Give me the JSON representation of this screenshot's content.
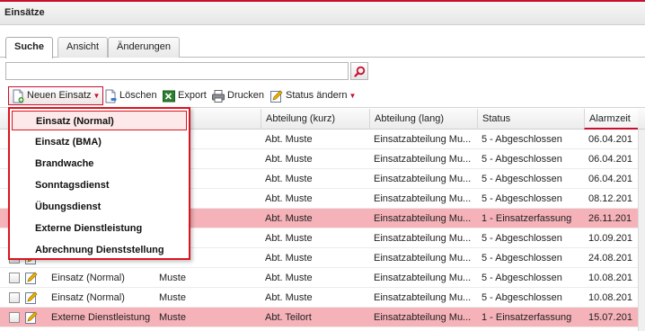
{
  "panel": {
    "title": "Einsätze"
  },
  "tabs": [
    {
      "label": "Suche",
      "active": true
    },
    {
      "label": "Ansicht",
      "active": false
    },
    {
      "label": "Änderungen",
      "active": false
    }
  ],
  "search": {
    "value": "",
    "placeholder": ""
  },
  "toolbar": {
    "new_label": "Neuen Einsatz",
    "delete_label": "Löschen",
    "export_label": "Export",
    "print_label": "Drucken",
    "status_label": "Status ändern"
  },
  "columns": {
    "abteilung_kurz": "Abteilung (kurz)",
    "abteilung_lang": "Abteilung (lang)",
    "status": "Status",
    "alarmzeit": "Alarmzeit"
  },
  "rows": [
    {
      "art": "",
      "name": "",
      "abt_kurz": "Abt. Muste",
      "abt_lang": "Einsatzabteilung Mu...",
      "status": "5 - Abgeschlossen",
      "alarm": "06.04.201",
      "alert": false
    },
    {
      "art": "",
      "name": "",
      "abt_kurz": "Abt. Muste",
      "abt_lang": "Einsatzabteilung Mu...",
      "status": "5 - Abgeschlossen",
      "alarm": "06.04.201",
      "alert": false
    },
    {
      "art": "",
      "name": "",
      "abt_kurz": "Abt. Muste",
      "abt_lang": "Einsatzabteilung Mu...",
      "status": "5 - Abgeschlossen",
      "alarm": "06.04.201",
      "alert": false
    },
    {
      "art": "",
      "name": "",
      "abt_kurz": "Abt. Muste",
      "abt_lang": "Einsatzabteilung Mu...",
      "status": "5 - Abgeschlossen",
      "alarm": "08.12.201",
      "alert": false
    },
    {
      "art": "",
      "name": "",
      "abt_kurz": "Abt. Muste",
      "abt_lang": "Einsatzabteilung Mu...",
      "status": "1 - Einsatzerfassung",
      "alarm": "26.11.201",
      "alert": true
    },
    {
      "art": "",
      "name": "",
      "abt_kurz": "Abt. Muste",
      "abt_lang": "Einsatzabteilung Mu...",
      "status": "5 - Abgeschlossen",
      "alarm": "10.09.201",
      "alert": false
    },
    {
      "art": "",
      "name": "",
      "abt_kurz": "Abt. Muste",
      "abt_lang": "Einsatzabteilung Mu...",
      "status": "5 - Abgeschlossen",
      "alarm": "24.08.201",
      "alert": false
    },
    {
      "art": "Einsatz (Normal)",
      "name": "Muste",
      "abt_kurz": "Abt. Muste",
      "abt_lang": "Einsatzabteilung Mu...",
      "status": "5 - Abgeschlossen",
      "alarm": "10.08.201",
      "alert": false
    },
    {
      "art": "Einsatz (Normal)",
      "name": "Muste",
      "abt_kurz": "Abt. Muste",
      "abt_lang": "Einsatzabteilung Mu...",
      "status": "5 - Abgeschlossen",
      "alarm": "10.08.201",
      "alert": false
    },
    {
      "art": "Externe Dienstleistung",
      "name": "Muste",
      "abt_kurz": "Abt. Teilort",
      "abt_lang": "Einsatzabteilung Mu...",
      "status": "1 - Einsatzerfassung",
      "alarm": "15.07.201",
      "alert": true
    }
  ],
  "dropdown": {
    "items": [
      "Einsatz (Normal)",
      "Einsatz (BMA)",
      "Brandwache",
      "Sonntagsdienst",
      "Übungsdienst",
      "Externe Dienstleistung",
      "Abrechnung Dienststellung"
    ],
    "highlighted_index": 0
  },
  "colors": {
    "accent": "#c8102e",
    "alert_row": "#f5b2b8",
    "menu_border": "#d9151f"
  }
}
